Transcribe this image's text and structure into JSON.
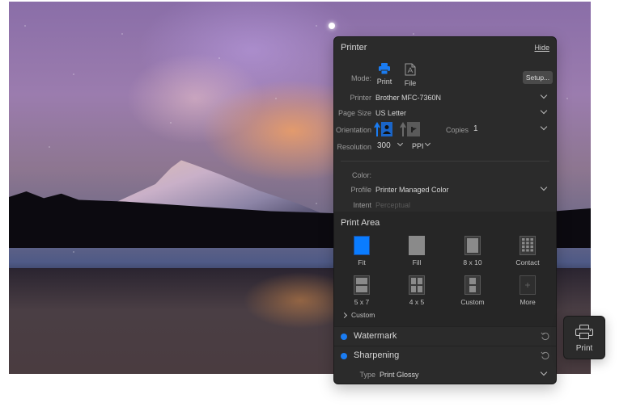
{
  "panel": {
    "title": "Printer",
    "hide_label": "Hide",
    "mode": {
      "label": "Mode:",
      "options": [
        {
          "label": "Print",
          "icon": "printer-icon",
          "selected": true
        },
        {
          "label": "File",
          "icon": "pdf-file-icon",
          "selected": false
        }
      ],
      "setup_label": "Setup..."
    },
    "printer": {
      "label": "Printer",
      "value": "Brother MFC-7360N"
    },
    "page_size": {
      "label": "Page Size",
      "value": "US Letter"
    },
    "orientation": {
      "label": "Orientation",
      "options": [
        {
          "name": "portrait",
          "selected": true
        },
        {
          "name": "landscape",
          "selected": false
        }
      ]
    },
    "copies": {
      "label": "Copies",
      "value": "1"
    },
    "resolution": {
      "label": "Resolution",
      "value": "300",
      "unit": "PPI"
    },
    "color": {
      "label": "Color:",
      "profile": {
        "label": "Profile",
        "value": "Printer Managed Color"
      },
      "intent": {
        "label": "Intent",
        "value": "Perceptual"
      }
    },
    "print_area": {
      "title": "Print Area",
      "items": [
        {
          "label": "Fit",
          "icon": "fit-layout-icon",
          "selected": true
        },
        {
          "label": "Fill",
          "icon": "fill-layout-icon",
          "selected": false
        },
        {
          "label": "8 x 10",
          "icon": "8x10-layout-icon",
          "selected": false
        },
        {
          "label": "Contact",
          "icon": "contact-sheet-icon",
          "selected": false
        },
        {
          "label": "5 x 7",
          "icon": "5x7-layout-icon",
          "selected": false
        },
        {
          "label": "4 x 5",
          "icon": "4x5-layout-icon",
          "selected": false
        },
        {
          "label": "Custom",
          "icon": "custom-layout-icon",
          "selected": false
        },
        {
          "label": "More",
          "icon": "add-more-icon",
          "selected": false
        }
      ],
      "custom_expander": "Custom"
    },
    "watermark": {
      "label": "Watermark",
      "enabled": true
    },
    "sharpening": {
      "label": "Sharpening",
      "enabled": true,
      "type_label": "Type",
      "type_value": "Print Glossy"
    }
  },
  "print_button": {
    "label": "Print"
  },
  "colors": {
    "accent": "#1a7cf2",
    "panel_bg": "#2b2b2b"
  }
}
